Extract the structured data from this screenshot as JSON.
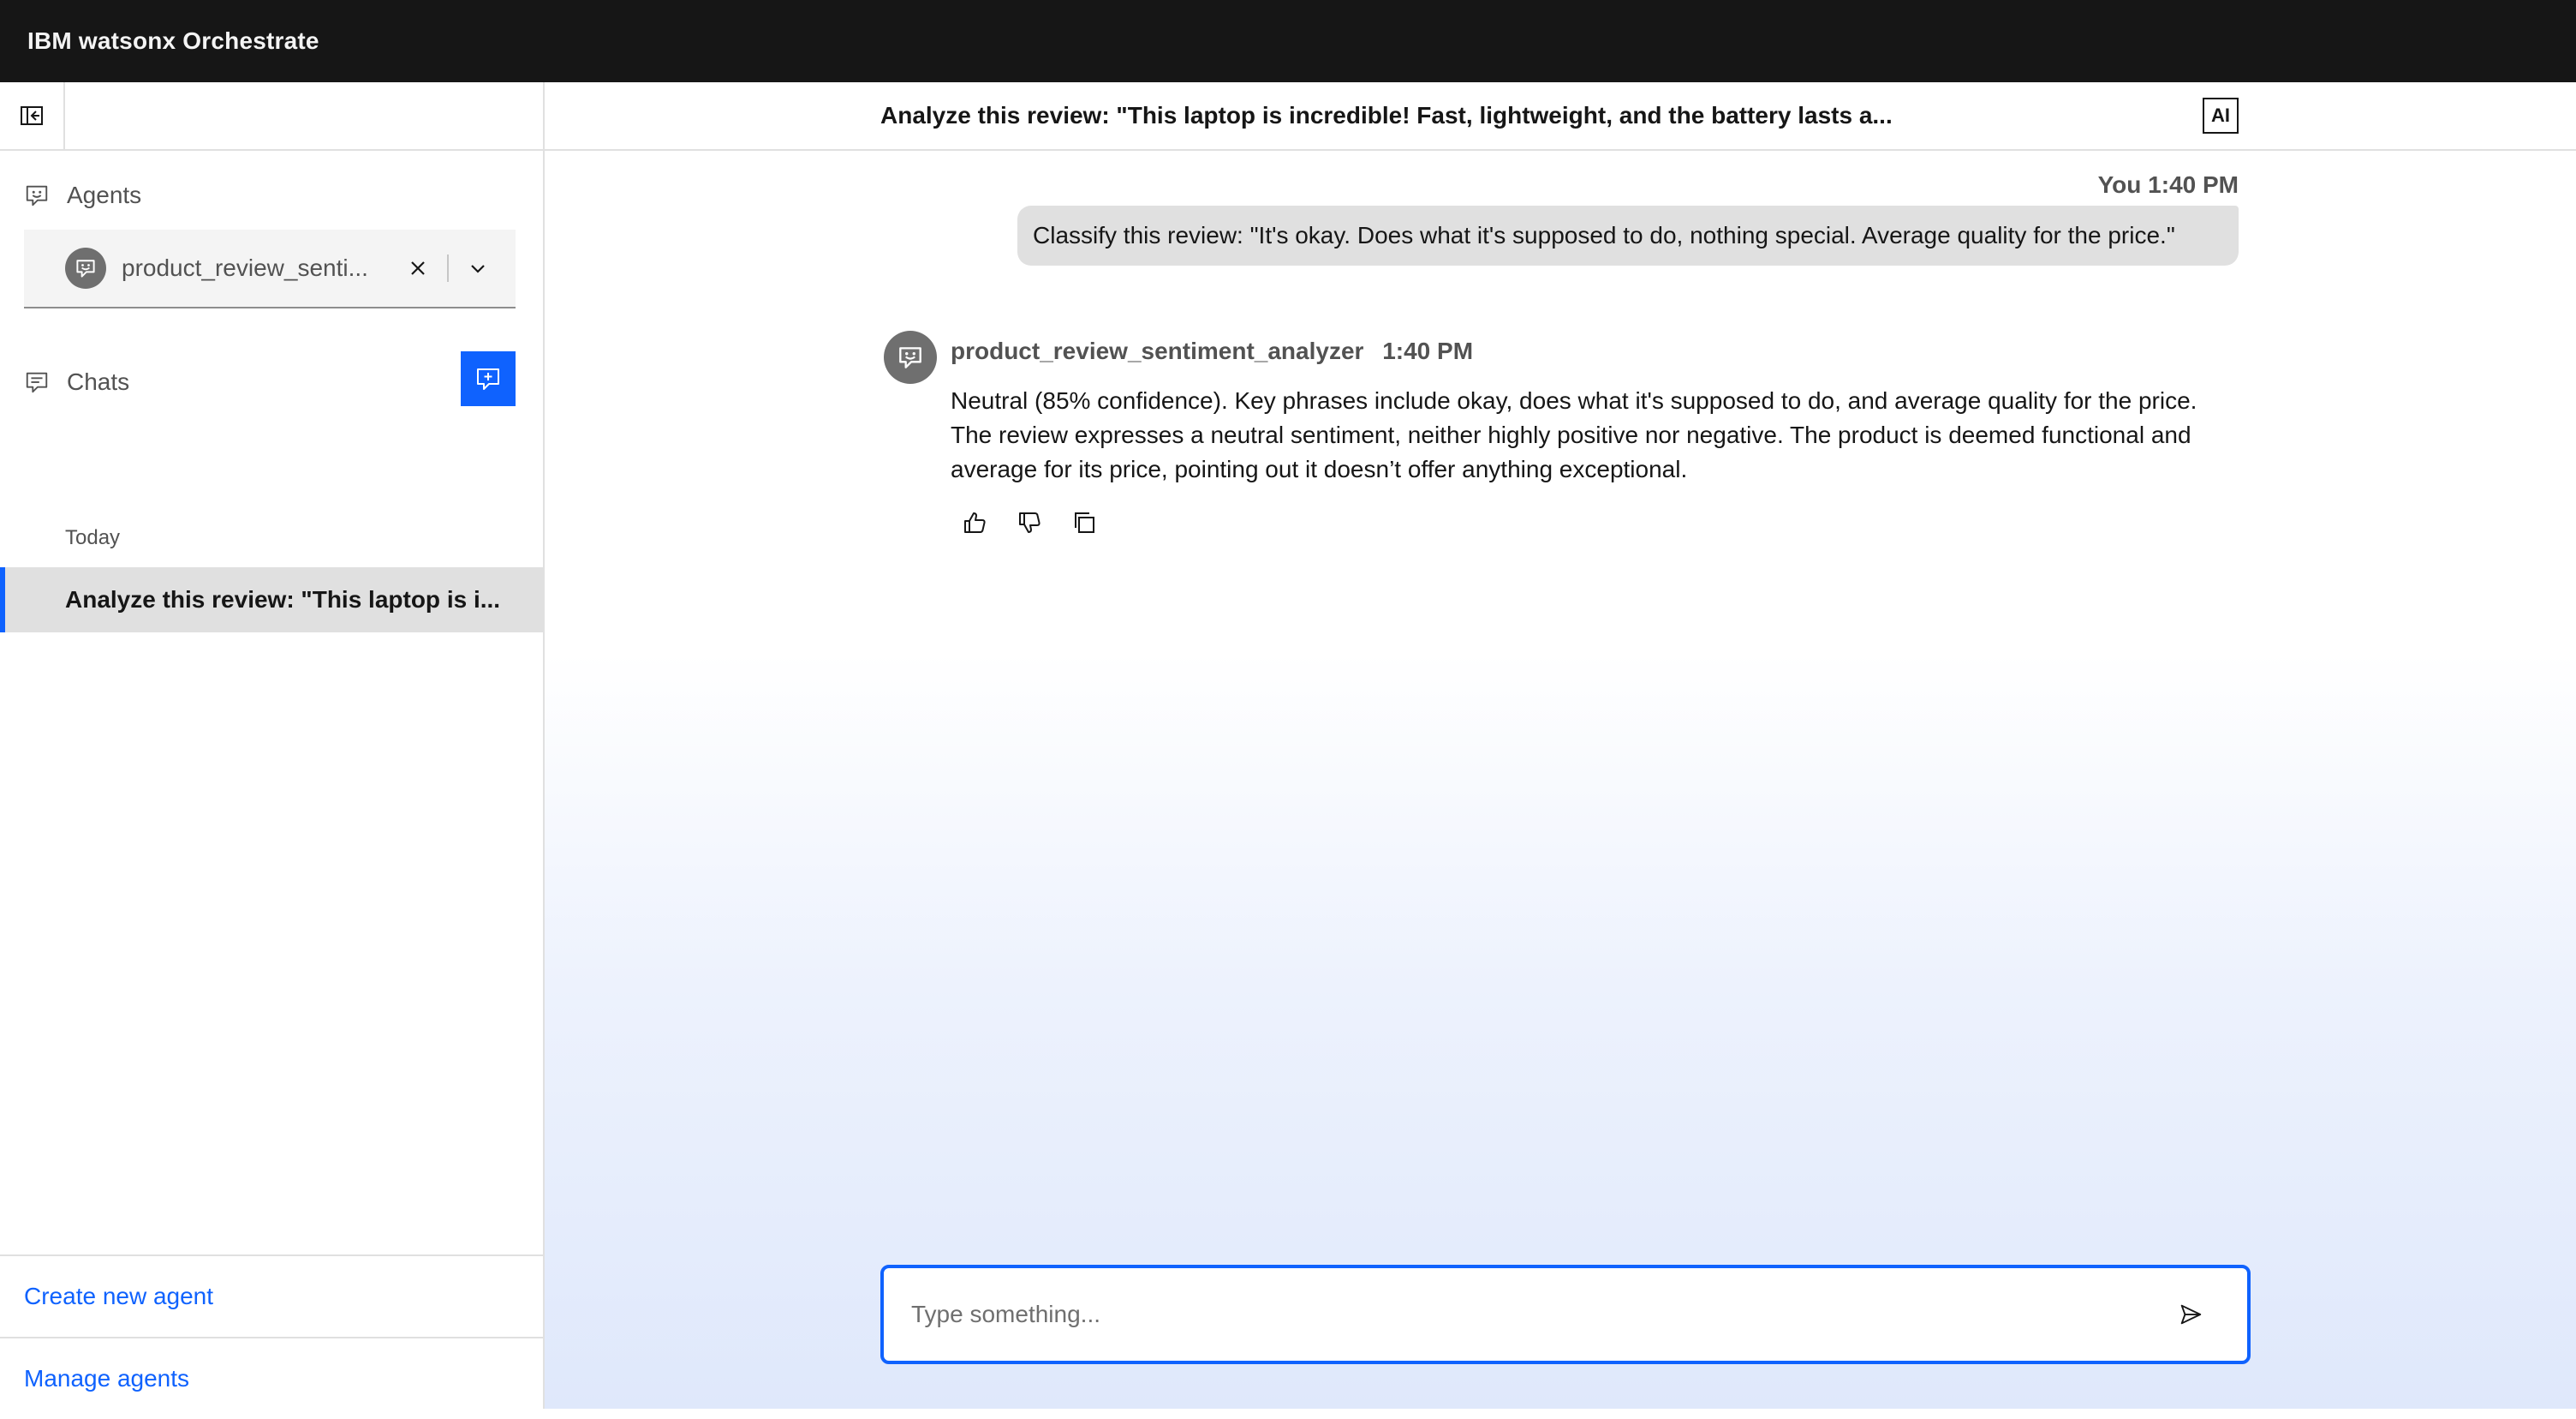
{
  "app": {
    "brand": "IBM watsonx Orchestrate"
  },
  "sidebar": {
    "agents_label": "Agents",
    "selected_agent": "product_review_senti...",
    "chats_label": "Chats",
    "today_label": "Today",
    "chat_items": [
      {
        "label": "Analyze this review: \"This laptop is i..."
      }
    ],
    "create_agent_link": "Create new agent",
    "manage_agents_link": "Manage agents"
  },
  "chat": {
    "title": "Analyze this review: \"This laptop is incredible! Fast, lightweight, and the battery lasts a...",
    "ai_badge": "AI",
    "user_message": {
      "author": "You",
      "time": "1:40 PM",
      "text": "Classify this review: \"It's okay. Does what it's supposed to do, nothing special. Average quality for the price.\""
    },
    "bot_message": {
      "author": "product_review_sentiment_analyzer",
      "time": "1:40 PM",
      "text": "Neutral (85% confidence). Key phrases include okay, does what it's supposed to do, and average quality for the price. The review expresses a neutral sentiment, neither highly positive nor negative. The product is deemed functional and average for its price, pointing out it doesn’t offer anything exceptional."
    },
    "composer": {
      "placeholder": "Type something...",
      "value": ""
    }
  },
  "colors": {
    "header_bg": "#161616",
    "accent": "#0f62fe",
    "selected_item_bg": "#e0e0e0",
    "avatar_bg": "#6f6f6f"
  },
  "icons": {
    "collapse": "sidebar-collapse-icon",
    "agent": "agent-chat-icon",
    "chats": "chat-bubbles-icon",
    "new_chat": "new-chat-icon",
    "clear": "close-icon",
    "dropdown": "chevron-down-icon",
    "thumbs_up": "thumbs-up-icon",
    "thumbs_down": "thumbs-down-icon",
    "copy": "copy-icon",
    "send": "send-icon"
  }
}
